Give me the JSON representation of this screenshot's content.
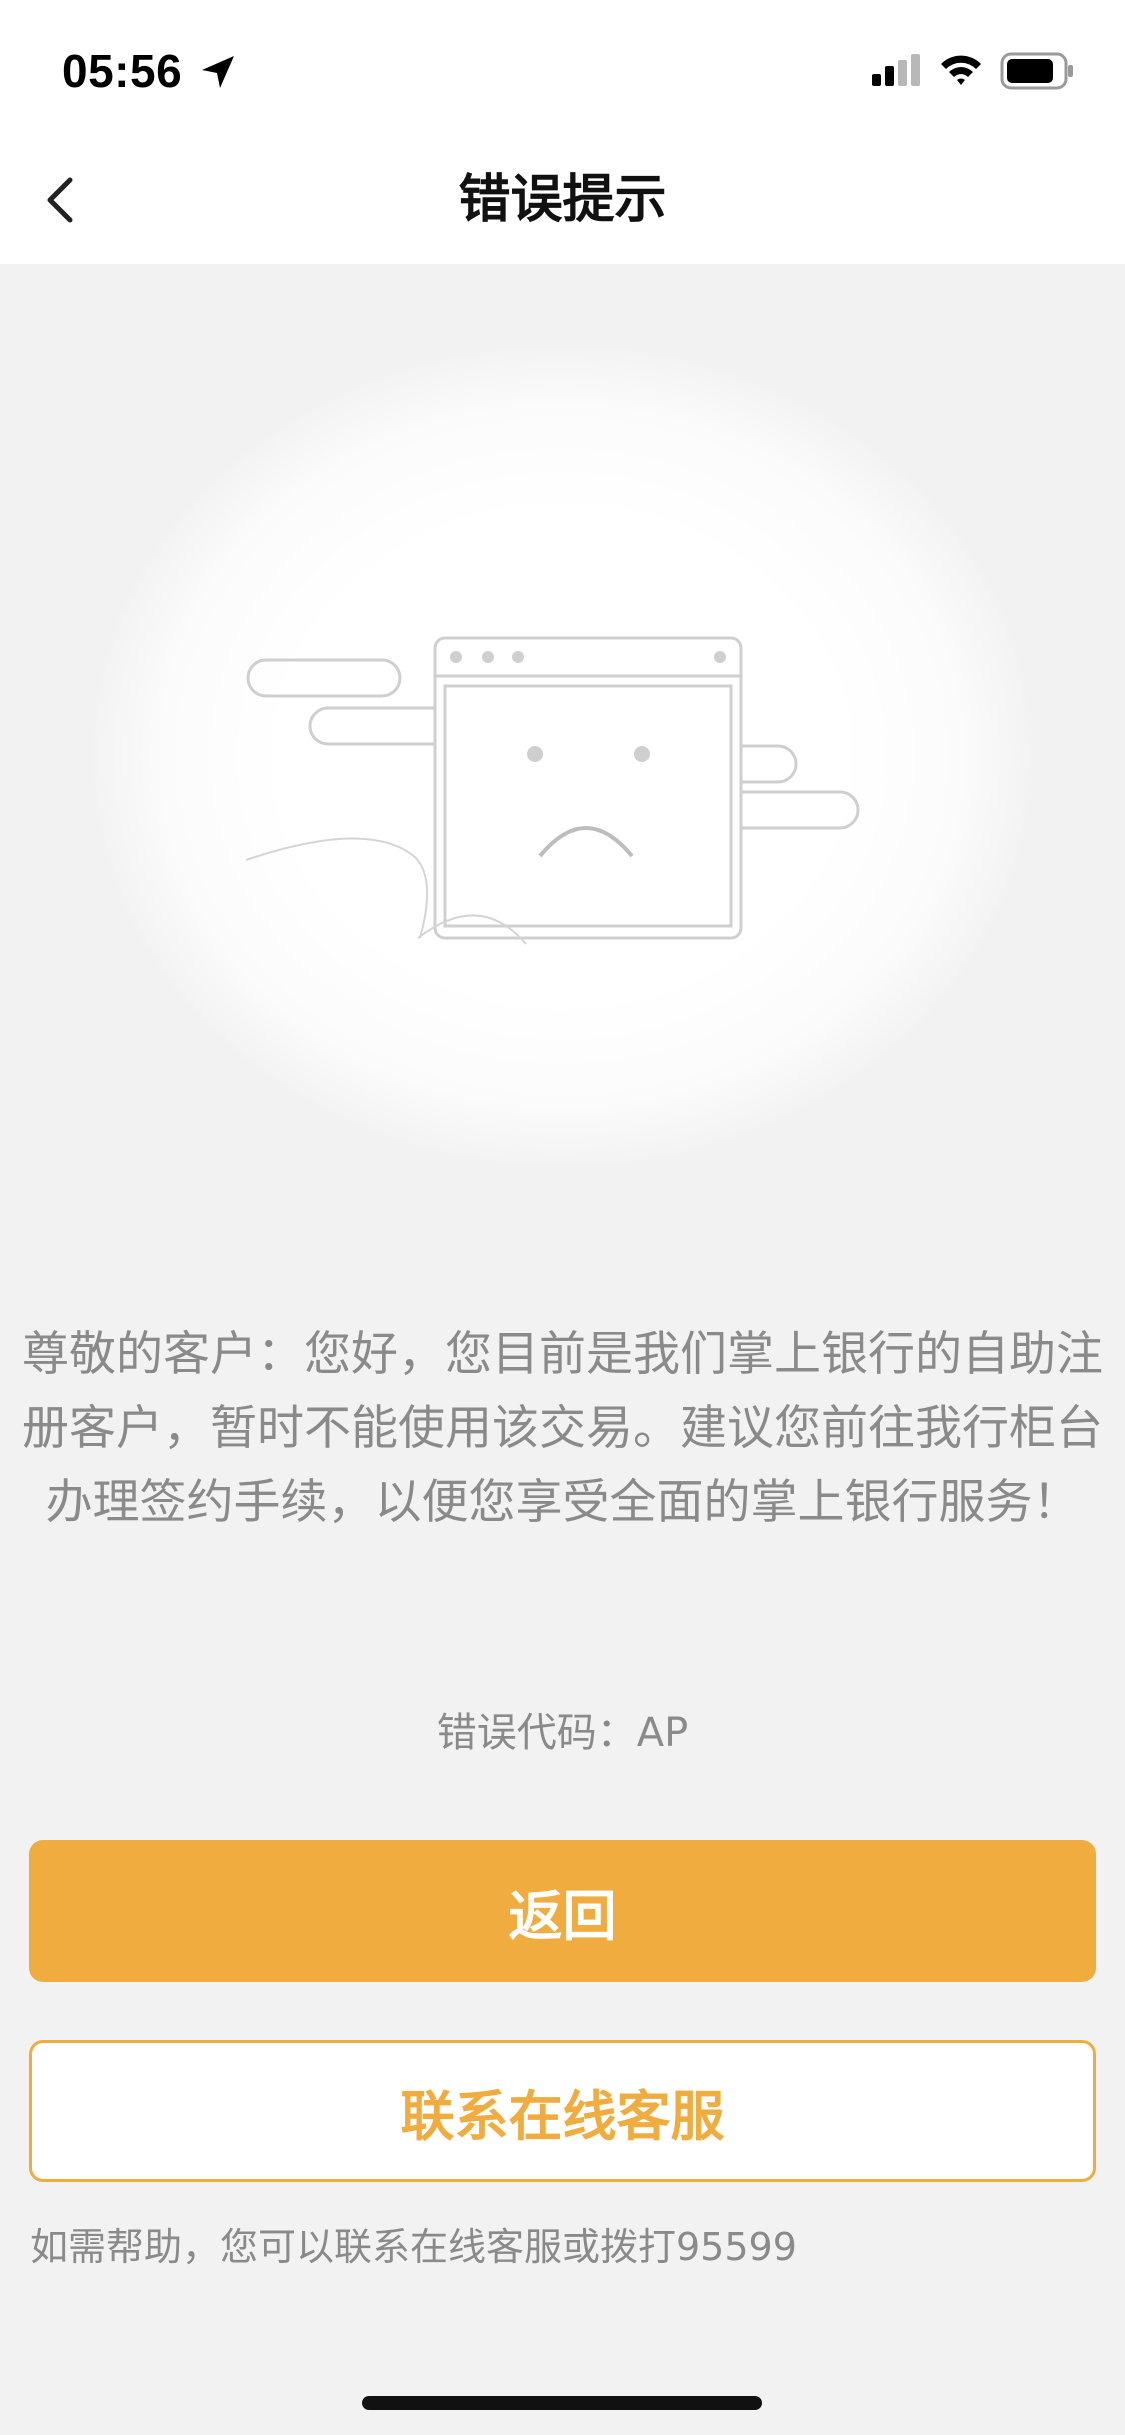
{
  "status_bar": {
    "time": "05:56",
    "icons": [
      "location-arrow-icon",
      "cellular-signal-icon",
      "wifi-icon",
      "battery-icon"
    ]
  },
  "nav": {
    "title": "错误提示",
    "back_icon": "chevron-left-icon"
  },
  "illustration": {
    "icon": "sad-browser-window-icon"
  },
  "message": {
    "text": "尊敬的客户：您好，您目前是我们掌上银行的自助注册客户，暂时不能使用该交易。建议您前往我行柜台办理签约手续，以便您享受全面的掌上银行服务！",
    "error_code": "错误代码：AP"
  },
  "buttons": {
    "back_label": "返回",
    "contact_label": "联系在线客服"
  },
  "help": {
    "text": "如需帮助，您可以联系在线客服或拨打95599"
  },
  "colors": {
    "accent": "#f0ac3f",
    "background": "#f2f2f2",
    "text_secondary": "#8a8a8a"
  }
}
